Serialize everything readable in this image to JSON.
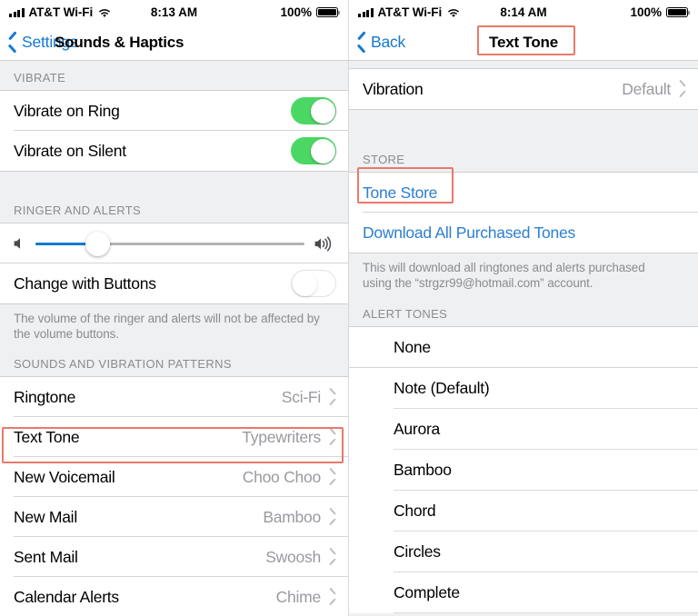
{
  "left": {
    "status": {
      "carrier": "AT&T Wi-Fi",
      "time": "8:13 AM",
      "battery_percent": "100%",
      "signal_icon": "cellular-bars-icon",
      "wifi_icon": "wifi-icon",
      "battery_icon": "battery-full-icon"
    },
    "nav": {
      "back_label": "Settings",
      "back_icon": "chevron-left-icon",
      "title": "Sounds & Haptics"
    },
    "sections": [
      {
        "header": "VIBRATE",
        "rows": [
          {
            "label": "Vibrate on Ring",
            "control": "toggle",
            "state": "on"
          },
          {
            "label": "Vibrate on Silent",
            "control": "toggle",
            "state": "on"
          }
        ]
      },
      {
        "header": "RINGER AND ALERTS",
        "slider": {
          "low_icon": "speaker-low-icon",
          "high_icon": "speaker-high-icon",
          "value_percent": 28
        },
        "rows": [
          {
            "label": "Change with Buttons",
            "control": "toggle",
            "state": "off"
          }
        ],
        "footnote": "The volume of the ringer and alerts will not be affected by the volume buttons."
      },
      {
        "header": "SOUNDS AND VIBRATION PATTERNS",
        "rows": [
          {
            "label": "Ringtone",
            "value": "Sci-Fi",
            "control": "chevron",
            "highlighted": false
          },
          {
            "label": "Text Tone",
            "value": "Typewriters",
            "control": "chevron",
            "highlighted": true
          },
          {
            "label": "New Voicemail",
            "value": "Choo Choo",
            "control": "chevron",
            "highlighted": false
          },
          {
            "label": "New Mail",
            "value": "Bamboo",
            "control": "chevron",
            "highlighted": false
          },
          {
            "label": "Sent Mail",
            "value": "Swoosh",
            "control": "chevron",
            "highlighted": false
          },
          {
            "label": "Calendar Alerts",
            "value": "Chime",
            "control": "chevron",
            "highlighted": false
          }
        ]
      }
    ]
  },
  "right": {
    "status": {
      "carrier": "AT&T Wi-Fi",
      "time": "8:14 AM",
      "battery_percent": "100%",
      "signal_icon": "cellular-bars-icon",
      "wifi_icon": "wifi-icon",
      "battery_icon": "battery-full-icon"
    },
    "nav": {
      "back_label": "Back",
      "back_icon": "chevron-left-icon",
      "title": "Text Tone",
      "title_highlighted": true
    },
    "vibration_row": {
      "label": "Vibration",
      "value": "Default",
      "control": "chevron"
    },
    "store_section": {
      "header": "STORE",
      "tone_store_label": "Tone Store",
      "tone_store_highlighted": true,
      "download_all_label": "Download All Purchased Tones",
      "footnote": "This will download all ringtones and alerts purchased using the “strgzr99@hotmail.com” account."
    },
    "alert_tones": {
      "header": "ALERT TONES",
      "items": [
        "None",
        "Note (Default)",
        "Aurora",
        "Bamboo",
        "Chord",
        "Circles",
        "Complete"
      ]
    }
  },
  "colors": {
    "highlight": "#e8796b",
    "link": "#2b7fd0",
    "toggle_on": "#4bd763",
    "slider_fill": "#1479d0",
    "section_bg": "#eff0f2",
    "value_text": "#9a9a9f"
  }
}
